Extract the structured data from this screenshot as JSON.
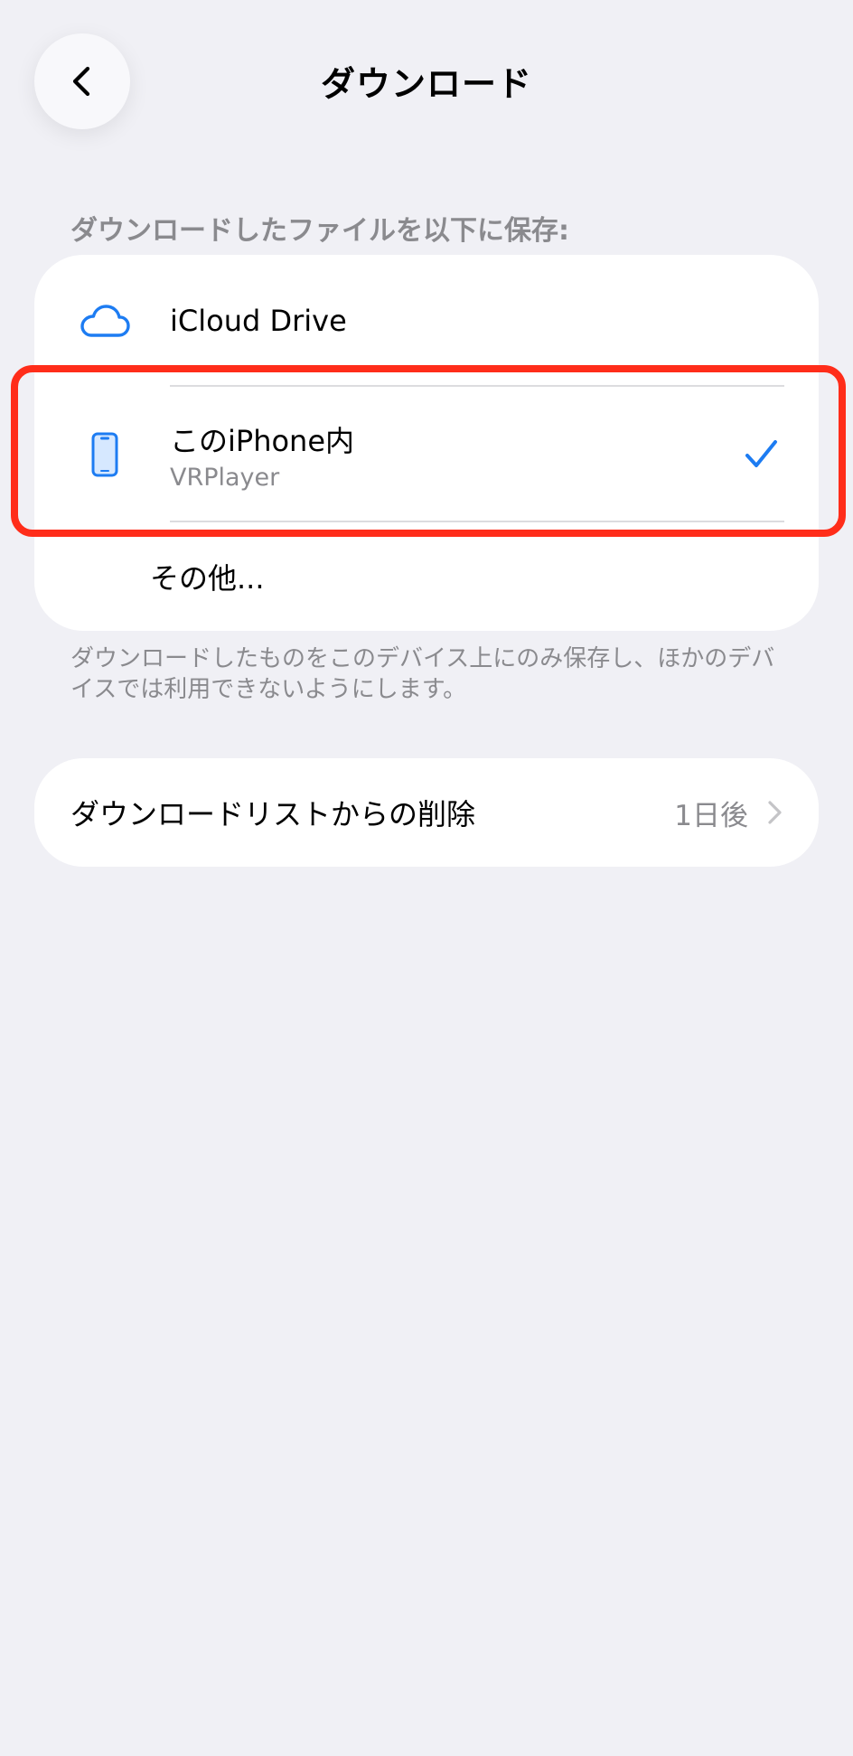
{
  "nav": {
    "title": "ダウンロード"
  },
  "storage_section": {
    "header": "ダウンロードしたファイルを以下に保存:",
    "options": [
      {
        "title": "iCloud Drive",
        "icon": "cloud-icon",
        "selected": false
      },
      {
        "title": "このiPhone内",
        "subtitle": "VRPlayer",
        "icon": "iphone-icon",
        "selected": true
      },
      {
        "title": "その他..."
      }
    ],
    "footer": "ダウンロードしたものをこのデバイス上にのみ保存し、ほかのデバイスでは利用できないようにします。"
  },
  "delete_section": {
    "label": "ダウンロードリストからの削除",
    "value": "1日後"
  },
  "colors": {
    "background": "#f0f0f5",
    "accent": "#1d7cf2",
    "highlight": "#ff2d1a",
    "secondary_text": "#8a8a8e"
  }
}
